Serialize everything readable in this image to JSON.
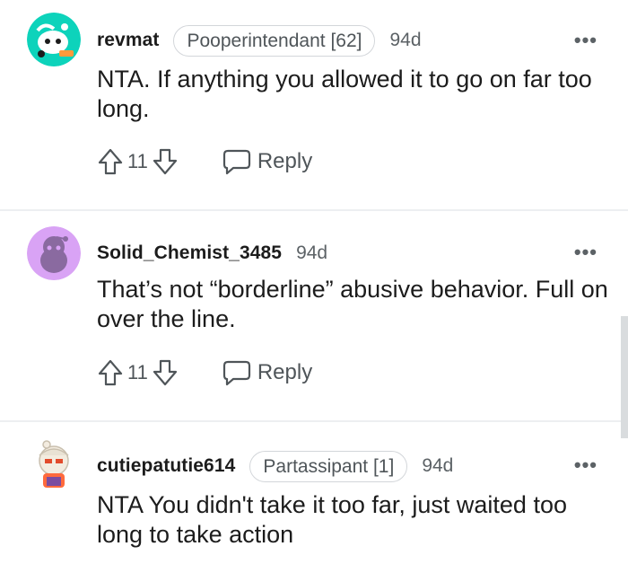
{
  "comments": [
    {
      "username": "revmat",
      "flair": "Pooperintendant [62]",
      "time": "94d",
      "more": "•••",
      "text": "NTA. If anything you allowed it to go on far too long.",
      "votes": "11",
      "reply_label": "Reply",
      "avatar_style": "snoo-teal"
    },
    {
      "username": "Solid_Chemist_3485",
      "flair": "",
      "time": "94d",
      "more": "•••",
      "text": "That’s not “borderline” abusive behavior. Full on over the line.",
      "votes": "11",
      "reply_label": "Reply",
      "avatar_style": "snoo-purple"
    },
    {
      "username": "cutiepatutie614",
      "flair": "Partassipant [1]",
      "time": "94d",
      "more": "•••",
      "text": "NTA You didn't take it too far, just waited too long to take action",
      "votes": "",
      "reply_label": "",
      "avatar_style": "snoo-custom"
    }
  ],
  "colors": {
    "text": "#1c1c1c",
    "meta": "#5c6266",
    "flair_border": "#d3d6da",
    "divider": "#edeff1",
    "avatar_teal": "#0dd3bb",
    "avatar_purple": "#d9a3f5"
  }
}
